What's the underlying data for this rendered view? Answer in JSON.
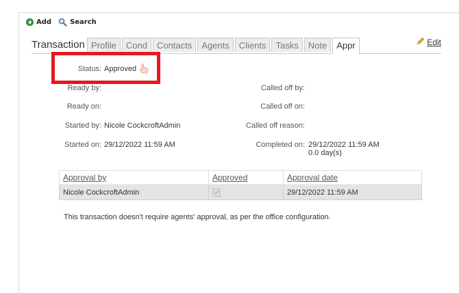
{
  "toolbar": {
    "add_label": "Add",
    "search_label": "Search"
  },
  "header": {
    "title": "Transaction",
    "edit_label": "Edit"
  },
  "tabs": [
    {
      "label": "Profile"
    },
    {
      "label": "Cond"
    },
    {
      "label": "Contacts"
    },
    {
      "label": "Agents"
    },
    {
      "label": "Clients"
    },
    {
      "label": "Tasks"
    },
    {
      "label": "Note"
    },
    {
      "label": "Appr"
    }
  ],
  "active_tab": "Appr",
  "status": {
    "label": "Status:",
    "value": "Approved"
  },
  "fields": {
    "ready_by": {
      "label": "Ready by:",
      "value": ""
    },
    "ready_on": {
      "label": "Ready on:",
      "value": ""
    },
    "started_by": {
      "label": "Started by:",
      "value": "Nicole CockcroftAdmin"
    },
    "started_on": {
      "label": "Started on:",
      "value": "29/12/2022 11:59 AM"
    },
    "called_off_by": {
      "label": "Called off by:",
      "value": ""
    },
    "called_off_on": {
      "label": "Called off on:",
      "value": ""
    },
    "called_off_reason": {
      "label": "Called off reason:",
      "value": ""
    },
    "completed_on": {
      "label": "Completed on:",
      "value": "29/12/2022 11:59 AM",
      "duration": "0.0 day(s)"
    }
  },
  "approvals": {
    "columns": [
      "Approval by",
      "Approved",
      "Approval date"
    ],
    "rows": [
      {
        "approval_by": "Nicole CockcroftAdmin",
        "approved": true,
        "approval_date": "29/12/2022 11:59 AM"
      }
    ]
  },
  "note": "This transaction doesn't require agents' approval, as per the office configuration.",
  "colors": {
    "highlight": "#e5171f",
    "add_icon": "#3a9b3a"
  },
  "icons": [
    "add-icon",
    "search-icon",
    "pencil-icon",
    "hand-pointer-icon"
  ]
}
